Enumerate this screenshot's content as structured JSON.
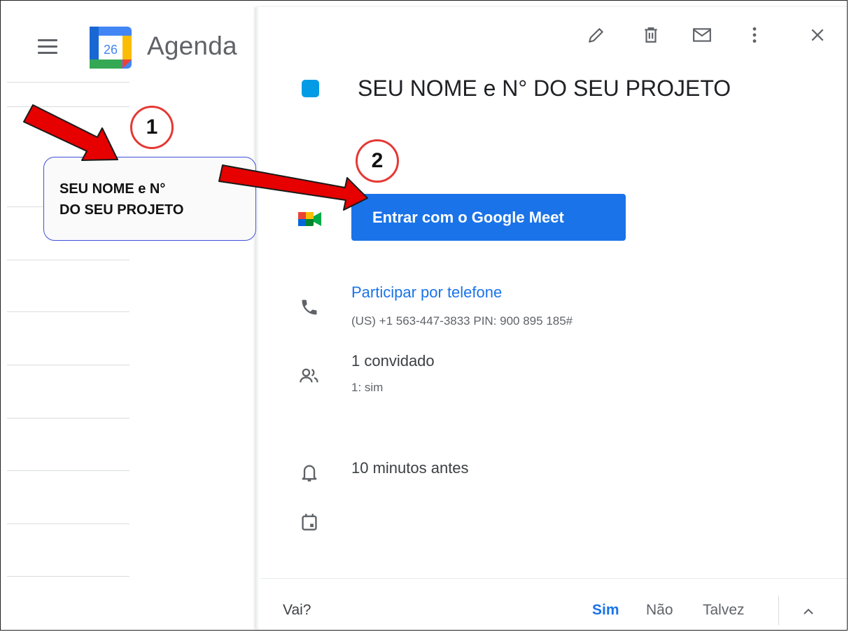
{
  "app": {
    "title": "Agenda",
    "calendar_day": "26",
    "menu_icon": "hamburger-menu-icon"
  },
  "toolbar": {
    "icons": [
      "edit-pencil-icon",
      "delete-trash-icon",
      "email-envelope-icon",
      "more-vert-icon",
      "close-icon"
    ]
  },
  "event": {
    "color": "#039be5",
    "title": "SEU NOME e N° DO SEU PROJETO"
  },
  "meet": {
    "button_label": "Entrar com o Google Meet",
    "button_color": "#1a73e8"
  },
  "phone": {
    "link_label": "Participar por telefone",
    "detail": "(US) +1 563-447-3833 PIN: 900 895 185#"
  },
  "guests": {
    "count_label": "1 convidado",
    "detail": "1: sim"
  },
  "reminder": {
    "label": "10 minutos antes"
  },
  "footer": {
    "question": "Vai?",
    "yes": "Sim",
    "no": "Não",
    "maybe": "Talvez"
  },
  "annotations": {
    "callout_line1": "SEU NOME e N°",
    "callout_line2": "DO SEU PROJETO",
    "step1": "1",
    "step2": "2",
    "arrow_color": "#e60000"
  }
}
